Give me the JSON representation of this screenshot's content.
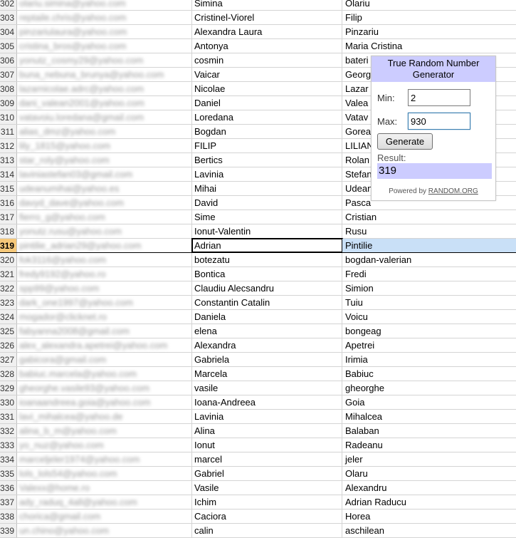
{
  "sheet": {
    "selected_row": "319",
    "rows": [
      {
        "n": "302",
        "email": "olariu.simina@yahoo.com",
        "first": "Simina",
        "last": "Olariu"
      },
      {
        "n": "303",
        "email": "reptaile.chris@yahoo.com",
        "first": "Cristinel-Viorel",
        "last": "Filip"
      },
      {
        "n": "304",
        "email": "pinzariulaura@yahoo.com",
        "first": "Alexandra Laura",
        "last": "Pinzariu"
      },
      {
        "n": "305",
        "email": "cristina_bros@yahoo.com",
        "first": "Antonya",
        "last": "Maria Cristina"
      },
      {
        "n": "306",
        "email": "yonutz_cosmy29@yahoo.com",
        "first": "cosmin",
        "last": "bateri"
      },
      {
        "n": "307",
        "email": "buna_nebuna_brunya@yahoo.com",
        "first": "Vaicar",
        "last": "Georg"
      },
      {
        "n": "308",
        "email": "lazarnicolae.adrc@yahoo.com",
        "first": "Nicolae",
        "last": "Lazar"
      },
      {
        "n": "309",
        "email": "dani_valean2001@yahoo.com",
        "first": "Daniel",
        "last": "Valea"
      },
      {
        "n": "310",
        "email": "vatavoiu.loredana@gmail.com",
        "first": "Loredana",
        "last": "Vatav"
      },
      {
        "n": "311",
        "email": "alias_dmz@yahoo.com",
        "first": "Bogdan",
        "last": "Gorea"
      },
      {
        "n": "312",
        "email": "lily_1815@yahoo.com",
        "first": "FILIP",
        "last": "LILIAN"
      },
      {
        "n": "313",
        "email": "star_roly@yahoo.com",
        "first": "Bertics",
        "last": "Rolan"
      },
      {
        "n": "314",
        "email": "laviniastefan03@gmail.com",
        "first": "Lavinia",
        "last": "Stefan"
      },
      {
        "n": "315",
        "email": "udeanumihai@yahoo.es",
        "first": "Mihai",
        "last": "Udean"
      },
      {
        "n": "316",
        "email": "davyd_dave@yahoo.com",
        "first": "David",
        "last": "Pasca"
      },
      {
        "n": "317",
        "email": "fierro_g@yahoo.com",
        "first": "Sime",
        "last": "Cristian"
      },
      {
        "n": "318",
        "email": "yonutz.rusu@yahoo.com",
        "first": "Ionut-Valentin",
        "last": "Rusu"
      },
      {
        "n": "319",
        "email": "pintilie_adrian29@yahoo.com",
        "first": "Adrian",
        "last": "Pintilie"
      },
      {
        "n": "320",
        "email": "fok3116@yahoo.com",
        "first": "botezatu",
        "last": "bogdan-valerian"
      },
      {
        "n": "321",
        "email": "fredy9192@yahoo.ro",
        "first": "Bontica",
        "last": "Fredi"
      },
      {
        "n": "322",
        "email": "spp99@yahoo.com",
        "first": "Claudiu Alecsandru",
        "last": "Simion"
      },
      {
        "n": "323",
        "email": "dark_one1997@yahoo.com",
        "first": "Constantin Catalin",
        "last": "Tuiu"
      },
      {
        "n": "324",
        "email": "mogador@clicknet.ro",
        "first": "Daniela",
        "last": "Voicu"
      },
      {
        "n": "325",
        "email": "fabyanna2008@gmail.com",
        "first": "elena",
        "last": "bongeag"
      },
      {
        "n": "326",
        "email": "alex_alexandra.apetrei@yahoo.com",
        "first": "Alexandra",
        "last": "Apetrei"
      },
      {
        "n": "327",
        "email": "gabicora@gmail.com",
        "first": "Gabriela",
        "last": "Irimia"
      },
      {
        "n": "328",
        "email": "babiuc.marcela@yahoo.com",
        "first": "Marcela",
        "last": "Babiuc"
      },
      {
        "n": "329",
        "email": "gheorghe.vasile93@yahoo.com",
        "first": "vasile",
        "last": "gheorghe"
      },
      {
        "n": "330",
        "email": "ioanaandreea.goia@yahoo.com",
        "first": "Ioana-Andreea",
        "last": "Goia"
      },
      {
        "n": "331",
        "email": "lavi_mihalcea@yahoo.de",
        "first": "Lavinia",
        "last": "Mihalcea"
      },
      {
        "n": "332",
        "email": "alina_b_m@yahoo.com",
        "first": "Alina",
        "last": "Balaban"
      },
      {
        "n": "333",
        "email": "yo_nuz@yahoo.com",
        "first": "Ionut",
        "last": "Radeanu"
      },
      {
        "n": "334",
        "email": "marceljeler1974@yahoo.com",
        "first": "marcel",
        "last": "jeler"
      },
      {
        "n": "335",
        "email": "lols_lols54@yahoo.com",
        "first": "Gabriel",
        "last": "Olaru"
      },
      {
        "n": "336",
        "email": "Valexx@home.ro",
        "first": "Vasile",
        "last": "Alexandru"
      },
      {
        "n": "337",
        "email": "ady_raduq_4all@yahoo.com",
        "first": "Ichim",
        "last": "Adrian Raducu"
      },
      {
        "n": "338",
        "email": "chorica@gmail.com",
        "first": "Caciora",
        "last": "Horea"
      },
      {
        "n": "339",
        "email": "un.chino@yahoo.com",
        "first": "calin",
        "last": "aschilean"
      }
    ]
  },
  "widget": {
    "title": "True Random Number Generator",
    "min_label": "Min:",
    "min_value": "2",
    "max_label": "Max:",
    "max_value": "930",
    "generate_label": "Generate",
    "result_label": "Result:",
    "result_value": "319",
    "powered_prefix": "Powered by",
    "powered_link": "RANDOM.ORG",
    "accent_color": "#ccccff"
  }
}
